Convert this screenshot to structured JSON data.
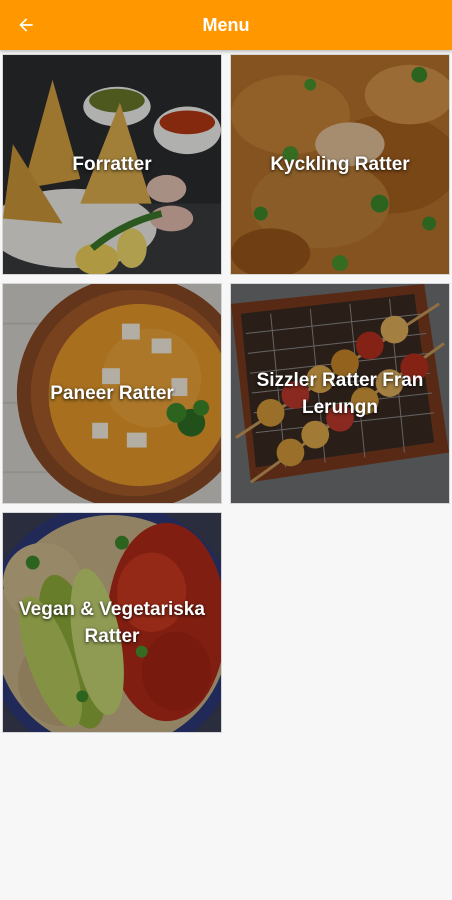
{
  "header": {
    "title": "Menu",
    "back_icon": "arrow-left-icon",
    "background": "#ff9800"
  },
  "categories": [
    {
      "label": "Forratter",
      "image": "samosa-plate"
    },
    {
      "label": "Kyckling Ratter",
      "image": "chicken-curry"
    },
    {
      "label": "Paneer Ratter",
      "image": "paneer-curry-bowl"
    },
    {
      "label": "Sizzler Ratter Fran Lerungn",
      "image": "skewers-grill"
    },
    {
      "label": "Vegan & Vegetariska Ratter",
      "image": "vegan-bowl"
    }
  ]
}
